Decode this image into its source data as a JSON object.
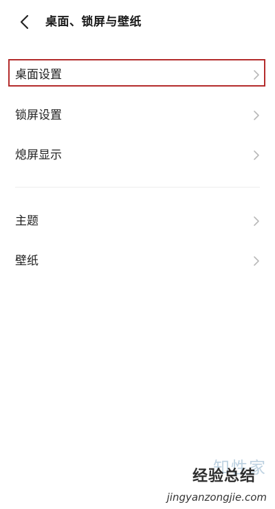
{
  "header": {
    "back_icon": "chevron-left-icon",
    "title": "桌面、锁屏与壁纸"
  },
  "rows": [
    {
      "label": "桌面设置",
      "highlighted": true
    },
    {
      "label": "锁屏设置"
    },
    {
      "label": "熄屏显示"
    },
    {
      "label": "主题"
    },
    {
      "label": "壁纸"
    }
  ],
  "colors": {
    "highlight_border": "#b32a2a",
    "chevron": "#b8b8b8",
    "divider": "#ececec"
  },
  "watermark": {
    "logo_text": "知性家",
    "site_name": "经验总结",
    "url": "jingyanzongjie.com"
  }
}
